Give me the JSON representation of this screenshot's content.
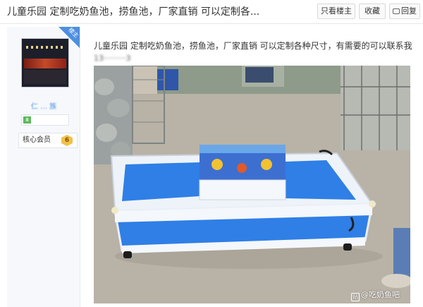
{
  "header": {
    "title": "儿童乐园 定制吃奶鱼池，捞鱼池，厂家直销 可以定制各...",
    "buttons": {
      "only_op": "只看楼主",
      "favorite": "收藏",
      "reply": "回复"
    }
  },
  "user": {
    "corner_tag": "楼主",
    "username": "仁 … 族",
    "badge_text": "Ⅲ",
    "level_label": "核心会员",
    "level_number": "6"
  },
  "post": {
    "text": "儿童乐园 定制吃奶鱼池，捞鱼池，厂家直销 可以定制各种尺寸，有需要的可以联系我",
    "phone_blurred": "13·········3",
    "watermark": "@吃奶鱼吧"
  },
  "colors": {
    "accent": "#4d8fe0",
    "pool_blue": "#2f7fe6",
    "frame_white": "#f4f7fb"
  }
}
